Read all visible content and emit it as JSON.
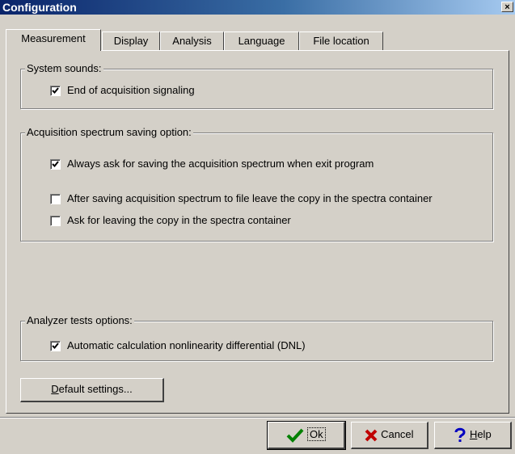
{
  "window": {
    "title": "Configuration",
    "close_glyph": "×"
  },
  "tabs": [
    {
      "label": "Measurement",
      "active": true
    },
    {
      "label": "Display",
      "active": false
    },
    {
      "label": "Analysis",
      "active": false
    },
    {
      "label": "Language",
      "active": false
    },
    {
      "label": "File location",
      "active": false
    }
  ],
  "system_sounds": {
    "title": "System sounds:",
    "options": [
      {
        "label": "End of acquisition signaling",
        "checked": true
      }
    ]
  },
  "acquisition_saving": {
    "title": "Acquisition spectrum saving option:",
    "options": [
      {
        "label": "Always ask for saving the acquisition spectrum when exit program",
        "checked": true
      },
      {
        "label": "After saving acquisition spectrum to file leave the copy in the spectra container",
        "checked": false
      },
      {
        "label": "Ask for leaving the copy in the spectra container",
        "checked": false
      }
    ]
  },
  "analyzer_tests": {
    "title": "Analyzer tests options:",
    "options": [
      {
        "label": "Automatic calculation nonlinearity differential (DNL)",
        "checked": true
      }
    ]
  },
  "default_settings": {
    "underline": "D",
    "rest": "efault settings..."
  },
  "footer": {
    "ok": {
      "label": "Ok",
      "icon": "checkmark-icon"
    },
    "cancel": {
      "label": "Cancel",
      "icon": "x-icon"
    },
    "help": {
      "underline": "H",
      "rest": "elp",
      "icon": "question-icon"
    }
  },
  "colors": {
    "title_start": "#0a246a",
    "title_end": "#a6caf0",
    "face": "#d4d0c8",
    "ok_check": "#008000",
    "cancel_x": "#c00000",
    "help_q": "#0000c0"
  }
}
